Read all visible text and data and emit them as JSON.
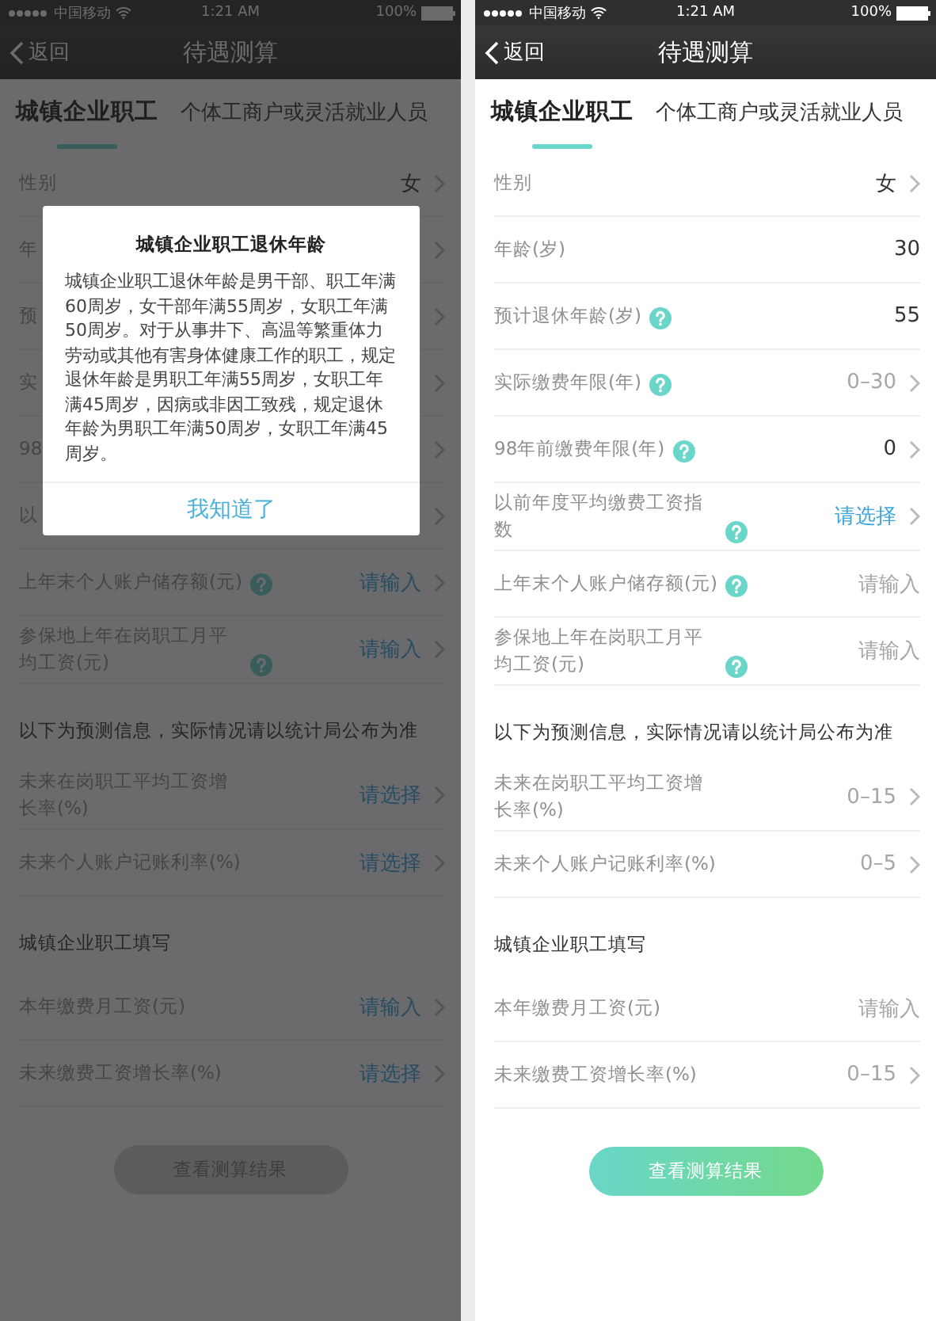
{
  "screens": [
    {
      "status_bar": {
        "carrier": "中国移动",
        "time": "1:21 AM",
        "battery": "100%"
      },
      "nav": {
        "back": "返回",
        "title": "待遇测算"
      },
      "tabs": [
        {
          "label": "城镇企业职工",
          "selected": true
        },
        {
          "label": "个体工商户或灵活就业人员",
          "selected": false
        }
      ],
      "groups": [
        {
          "rows": [
            {
              "label": "性别",
              "value": "女",
              "help": false,
              "chevron": true
            },
            {
              "label": "年",
              "help": false,
              "chevron": true
            },
            {
              "label": "预",
              "help": false,
              "chevron": true
            },
            {
              "label": "实",
              "help": false,
              "chevron": true
            },
            {
              "label": "98",
              "help": false,
              "chevron": true
            },
            {
              "label": "以",
              "help": false,
              "chevron": true
            },
            {
              "label": "上年末个人账户储存额(元)",
              "help": true,
              "prompt": "请输入",
              "chevron": true
            },
            {
              "label": "参保地上年在岗职工月平均工资(元)",
              "help": true,
              "prompt": "请输入",
              "chevron": true
            }
          ]
        },
        {
          "heading": "以下为预测信息，实际情况请以统计局公布为准",
          "rows": [
            {
              "label": "未来在岗职工平均工资增长率(%)",
              "help": false,
              "prompt": "请选择",
              "chevron": true
            },
            {
              "label": "未来个人账户记账利率(%)",
              "help": false,
              "prompt": "请选择",
              "chevron": true
            }
          ]
        },
        {
          "heading": "城镇企业职工填写",
          "rows": [
            {
              "label": "本年缴费月工资(元)",
              "help": false,
              "prompt": "请输入",
              "chevron": true
            },
            {
              "label": "未来缴费工资增长率(%)",
              "help": false,
              "prompt": "请选择",
              "chevron": true
            }
          ]
        }
      ],
      "button": {
        "label": "查看测算结果",
        "disabled": true
      },
      "dimmed": true,
      "dialog": {
        "title": "城镇企业职工退休年龄",
        "body": "城镇企业职工退休年龄是男干部、职工年满60周岁，女干部年满55周岁，女职工年满50周岁。对于从事井下、高温等繁重体力劳动或其他有害身体健康工作的职工，规定退休年龄是男职工年满55周岁，女职工年满45周岁，因病或非因工致残，规定退休年龄为男职工年满50周岁，女职工年满45周岁。",
        "action": "我知道了"
      }
    },
    {
      "status_bar": {
        "carrier": "中国移动",
        "time": "1:21 AM",
        "battery": "100%"
      },
      "nav": {
        "back": "返回",
        "title": "待遇测算"
      },
      "tabs": [
        {
          "label": "城镇企业职工",
          "selected": true
        },
        {
          "label": "个体工商户或灵活就业人员",
          "selected": false
        }
      ],
      "groups": [
        {
          "rows": [
            {
              "label": "性别",
              "value": "女",
              "help": false,
              "chevron": true
            },
            {
              "label": "年龄(岁)",
              "value": "30",
              "help": false,
              "chevron": false
            },
            {
              "label": "预计退休年龄(岁)",
              "help": true,
              "value": "55",
              "chevron": false
            },
            {
              "label": "实际缴费年限(年)",
              "help": true,
              "placeholder": "0–30",
              "chevron": true
            },
            {
              "label": "98年前缴费年限(年)",
              "help": true,
              "value": "0",
              "chevron": true
            },
            {
              "label": "以前年度平均缴费工资指数",
              "help": true,
              "prompt": "请选择",
              "chevron": true
            },
            {
              "label": "上年末个人账户储存额(元)",
              "help": true,
              "placeholder": "请输入",
              "chevron": false
            },
            {
              "label": "参保地上年在岗职工月平均工资(元)",
              "help": true,
              "placeholder": "请输入",
              "chevron": false
            }
          ]
        },
        {
          "heading": "以下为预测信息，实际情况请以统计局公布为准",
          "rows": [
            {
              "label": "未来在岗职工平均工资增长率(%)",
              "help": false,
              "placeholder": "0–15",
              "chevron": true
            },
            {
              "label": "未来个人账户记账利率(%)",
              "help": false,
              "placeholder": "0–5",
              "chevron": true
            }
          ]
        },
        {
          "heading": "城镇企业职工填写",
          "rows": [
            {
              "label": "本年缴费月工资(元)",
              "help": false,
              "placeholder": "请输入",
              "chevron": false
            },
            {
              "label": "未来缴费工资增长率(%)",
              "help": false,
              "placeholder": "0–15",
              "chevron": true
            }
          ]
        }
      ],
      "button": {
        "label": "查看测算结果",
        "disabled": false
      },
      "dimmed": false
    }
  ]
}
